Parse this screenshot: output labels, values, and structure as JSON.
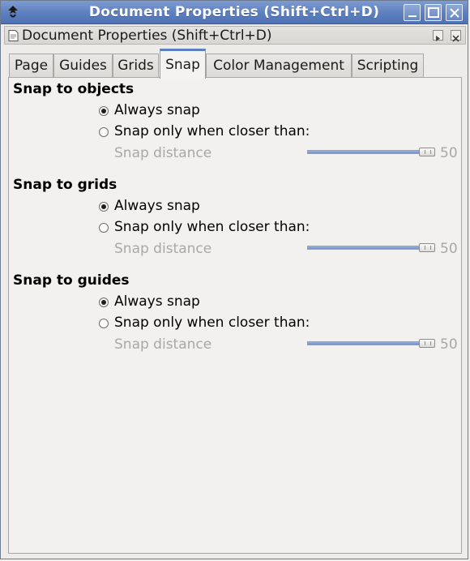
{
  "window": {
    "title": "Document Properties (Shift+Ctrl+D)"
  },
  "dock": {
    "title": "Document Properties (Shift+Ctrl+D)"
  },
  "tabs": [
    {
      "label": "Page"
    },
    {
      "label": "Guides"
    },
    {
      "label": "Grids"
    },
    {
      "label": "Snap"
    },
    {
      "label": "Color Management"
    },
    {
      "label": "Scripting"
    }
  ],
  "active_tab": "Snap",
  "sections": [
    {
      "title": "Snap to objects",
      "option_always": "Always snap",
      "option_closer": "Snap only when closer than:",
      "selected": "always",
      "distance_label": "Snap distance",
      "distance_value": "50"
    },
    {
      "title": "Snap to grids",
      "option_always": "Always snap",
      "option_closer": "Snap only when closer than:",
      "selected": "always",
      "distance_label": "Snap distance",
      "distance_value": "50"
    },
    {
      "title": "Snap to guides",
      "option_always": "Always snap",
      "option_closer": "Snap only when closer than:",
      "selected": "always",
      "distance_label": "Snap distance",
      "distance_value": "50"
    }
  ],
  "colors": {
    "titlebar": "#5d7fbf",
    "active_tab_accent": "#5a80c2",
    "disabled_text": "#a9a8a5"
  }
}
